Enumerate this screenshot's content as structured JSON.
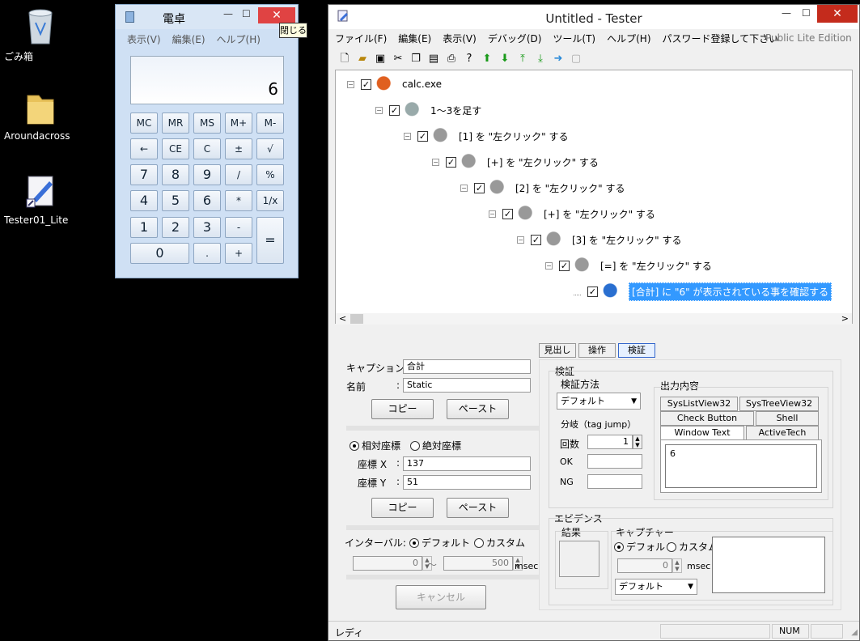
{
  "desktop": {
    "icons": [
      {
        "label": "ごみ箱",
        "icon": "recycle-bin-icon"
      },
      {
        "label": "Aroundacross",
        "icon": "folder-icon"
      },
      {
        "label": "Tester01_Lite",
        "icon": "app-shortcut-icon"
      }
    ]
  },
  "calculator": {
    "title": "電卓",
    "close_symbol": "✕",
    "tooltip": "閉じる",
    "menu": [
      "表示(V)",
      "編集(E)",
      "ヘルプ(H)"
    ],
    "display": "6",
    "buttons": [
      [
        "MC",
        "MR",
        "MS",
        "M+",
        "M-"
      ],
      [
        "←",
        "CE",
        "C",
        "±",
        "√"
      ],
      [
        "7",
        "8",
        "9",
        "/",
        "%"
      ],
      [
        "4",
        "5",
        "6",
        "*",
        "1/x"
      ],
      [
        "1",
        "2",
        "3",
        "-",
        "="
      ],
      [
        "0",
        ".",
        "+"
      ]
    ]
  },
  "tester": {
    "title": "Untitled - Tester",
    "menu": [
      "ファイル(F)",
      "編集(E)",
      "表示(V)",
      "デバッグ(D)",
      "ツール(T)",
      "ヘルプ(H)",
      "パスワード登録して下さい"
    ],
    "edition": "Public Lite Edition",
    "tree": [
      {
        "label": "calc.exe",
        "level": 0,
        "icon": "application-icon"
      },
      {
        "label": "1～3を足す",
        "level": 1,
        "icon": "script-icon"
      },
      {
        "label": "[1] を \"左クリック\" する",
        "level": 2,
        "icon": "mouse-click-icon"
      },
      {
        "label": "[+] を \"左クリック\" する",
        "level": 3,
        "icon": "mouse-click-icon"
      },
      {
        "label": "[2] を \"左クリック\" する",
        "level": 4,
        "icon": "mouse-click-icon"
      },
      {
        "label": "[+] を \"左クリック\" する",
        "level": 5,
        "icon": "mouse-click-icon"
      },
      {
        "label": "[3] を \"左クリック\" する",
        "level": 6,
        "icon": "mouse-click-icon"
      },
      {
        "label": "[=] を \"左クリック\" する",
        "level": 7,
        "icon": "mouse-click-icon"
      },
      {
        "label": "[合計] に \"6\" が表示されている事を確認する",
        "level": 8,
        "icon": "verify-user-icon",
        "selected": true
      }
    ],
    "props": {
      "caption_label": "キャプション:",
      "caption_value": "合計",
      "name_label": "名前",
      "name_colon": ":",
      "name_value": "Static",
      "copy": "コピー",
      "paste": "ペースト",
      "relative": "相対座標",
      "absolute": "絶対座標",
      "x_label": "座標 X",
      "x_value": "137",
      "y_label": "座標 Y",
      "y_value": "51",
      "interval_label": "インターバル:",
      "default": "デフォルト",
      "custom": "カスタム",
      "from_value": "0",
      "to_value": "500",
      "tilde": "～",
      "msec": "msec",
      "cancel": "キャンセル"
    },
    "tabs": [
      "見出し",
      "操作",
      "検証"
    ],
    "verify": {
      "group": "検証",
      "method_label": "検証方法",
      "method_value": "デフォルト",
      "branch_label": "分岐（tag jump）",
      "count_label": "回数",
      "count_value": "1",
      "ok_label": "OK",
      "ng_label": "NG",
      "output_label": "出力内容",
      "out_tabs": [
        "SysListView32",
        "SysTreeView32",
        "Check Button",
        "Shell",
        "Window Text",
        "ActiveTech"
      ],
      "output_value": "6"
    },
    "evidence": {
      "group": "エビデンス",
      "result_label": "結果",
      "capture_label": "キャプチャー",
      "default": "デフォルト",
      "custom": "カスタム",
      "value": "0",
      "msec": "msec",
      "select_value": "デフォルト"
    },
    "status": {
      "left": "レディ",
      "num": "NUM"
    }
  }
}
